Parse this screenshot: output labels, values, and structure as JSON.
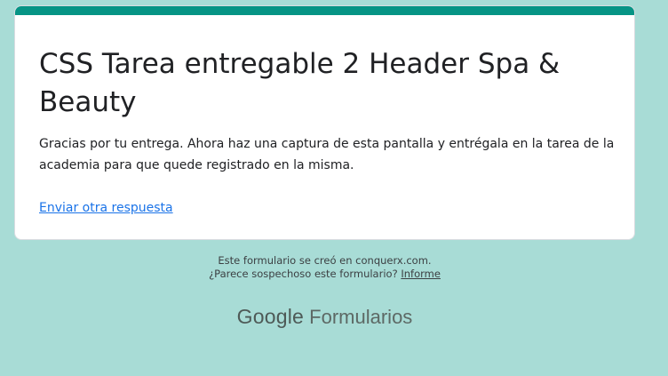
{
  "form": {
    "title": "CSS Tarea entregable 2 Header Spa & Beauty",
    "confirmation_message": "Gracias por tu entrega. Ahora haz una captura de esta pantalla y entrégala en la tarea de la academia para que quede registrado en la misma.",
    "submit_another_link": "Enviar otra respuesta"
  },
  "footer": {
    "created_notice": "Este formulario se creó en conquerx.com.",
    "suspicious_prompt": "¿Parece sospechoso este formulario?",
    "report_link": "Informe"
  },
  "brand": {
    "google": "Google",
    "product": "Formularios"
  },
  "colors": {
    "background": "#a8dcd6",
    "accent": "#069485",
    "link": "#1a73e8"
  }
}
